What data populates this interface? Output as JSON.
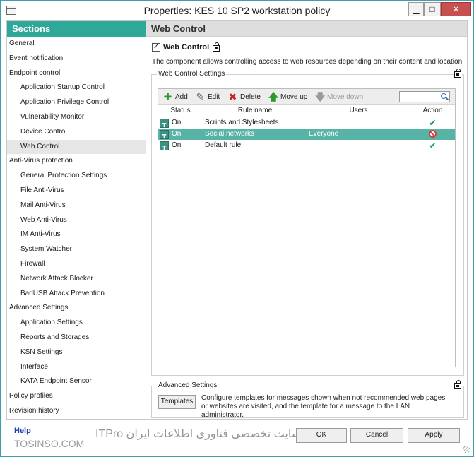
{
  "window": {
    "title": "Properties: KES 10 SP2 workstation policy",
    "minimize_glyph": "▁",
    "maximize_glyph": "□",
    "close_glyph": "✕"
  },
  "sidebar": {
    "header": "Sections",
    "items": [
      {
        "label": "General",
        "level": 0
      },
      {
        "label": "Event notification",
        "level": 0
      },
      {
        "label": "Endpoint control",
        "level": 0
      },
      {
        "label": "Application Startup Control",
        "level": 1
      },
      {
        "label": "Application Privilege Control",
        "level": 1
      },
      {
        "label": "Vulnerability Monitor",
        "level": 1
      },
      {
        "label": "Device Control",
        "level": 1
      },
      {
        "label": "Web Control",
        "level": 1,
        "selected": true
      },
      {
        "label": "Anti-Virus protection",
        "level": 0
      },
      {
        "label": "General Protection Settings",
        "level": 1
      },
      {
        "label": "File Anti-Virus",
        "level": 1
      },
      {
        "label": "Mail Anti-Virus",
        "level": 1
      },
      {
        "label": "Web Anti-Virus",
        "level": 1
      },
      {
        "label": "IM Anti-Virus",
        "level": 1
      },
      {
        "label": "System Watcher",
        "level": 1
      },
      {
        "label": "Firewall",
        "level": 1
      },
      {
        "label": "Network Attack Blocker",
        "level": 1
      },
      {
        "label": "BadUSB Attack Prevention",
        "level": 1
      },
      {
        "label": "Advanced Settings",
        "level": 0
      },
      {
        "label": "Application Settings",
        "level": 1
      },
      {
        "label": "Reports and Storages",
        "level": 1
      },
      {
        "label": "KSN Settings",
        "level": 1
      },
      {
        "label": "Interface",
        "level": 1
      },
      {
        "label": "KATA Endpoint Sensor",
        "level": 1
      },
      {
        "label": "Policy profiles",
        "level": 0
      },
      {
        "label": "Revision history",
        "level": 0
      }
    ]
  },
  "panel": {
    "header": "Web Control",
    "enable_label": "Web Control",
    "enable_glyph": "✓",
    "description": "The component allows controlling access to web resources depending on their content and location.",
    "settings_group_title": "Web Control Settings",
    "toolbar": {
      "add_label": "Add",
      "add_glyph": "✚",
      "edit_label": "Edit",
      "edit_glyph": "✎",
      "delete_label": "Delete",
      "delete_glyph": "✖",
      "move_up_label": "Move up",
      "move_up_glyph": "🡅",
      "move_down_label": "Move down",
      "move_down_glyph": "🡇",
      "search_value": ""
    },
    "table": {
      "columns": [
        "Status",
        "Rule name",
        "Users",
        "Action"
      ],
      "rows": [
        {
          "status": "On",
          "rule": "Scripts and Stylesheets",
          "users": "",
          "action": "allow",
          "selected": false
        },
        {
          "status": "On",
          "rule": "Social networks",
          "users": "Everyone",
          "action": "block",
          "selected": true
        },
        {
          "status": "On",
          "rule": "Default rule",
          "users": "",
          "action": "allow",
          "selected": false
        }
      ]
    },
    "advanced_group_title": "Advanced Settings",
    "templates_button": "Templates",
    "templates_description": "Configure templates for messages shown when not recommended web pages or websites are visited, and the template for a message to the LAN administrator."
  },
  "footer": {
    "help_link": "Help",
    "ok_button": "OK",
    "cancel_button": "Cancel",
    "apply_button": "Apply",
    "watermark_left": "TOSINSO.COM",
    "watermark_right": "وب سایت تخصصی فناوری اطلاعات ایران ITPro"
  },
  "colors": {
    "accent": "#2ea898",
    "selected_row": "#57b3a5",
    "allow": "#1f9a52",
    "block": "#d83b3b"
  },
  "icons": {
    "rule_status": "rule-enabled-icon",
    "allow": "check-icon",
    "block": "prohibited-icon",
    "policy_lock": "lock-icon",
    "search": "search-icon"
  }
}
